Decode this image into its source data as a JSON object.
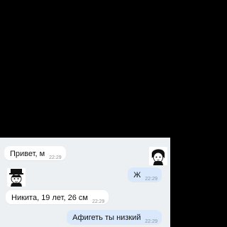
{
  "chat": {
    "messages": [
      {
        "text": "Привет, м",
        "time": "22:29",
        "direction": "in"
      },
      {
        "text": "Ж",
        "time": "22:29",
        "direction": "out"
      },
      {
        "text": "Никита, 19 лет, 26 см",
        "time": "22:29",
        "direction": "in"
      },
      {
        "text": "Афигеть ты низкий",
        "time": "22:29",
        "direction": "out"
      }
    ],
    "avatars": [
      {
        "name": "anime-avatar-right",
        "icon": "anime-avatar-icon"
      },
      {
        "name": "anime-avatar-left",
        "icon": "anime-avatar-icon"
      }
    ]
  },
  "colors": {
    "screen_background": "#000000",
    "chat_background": "#edf0f3",
    "incoming_bubble": "#ffffff",
    "outgoing_bubble": "#d9e8fb",
    "timestamp": "#8f959c"
  }
}
